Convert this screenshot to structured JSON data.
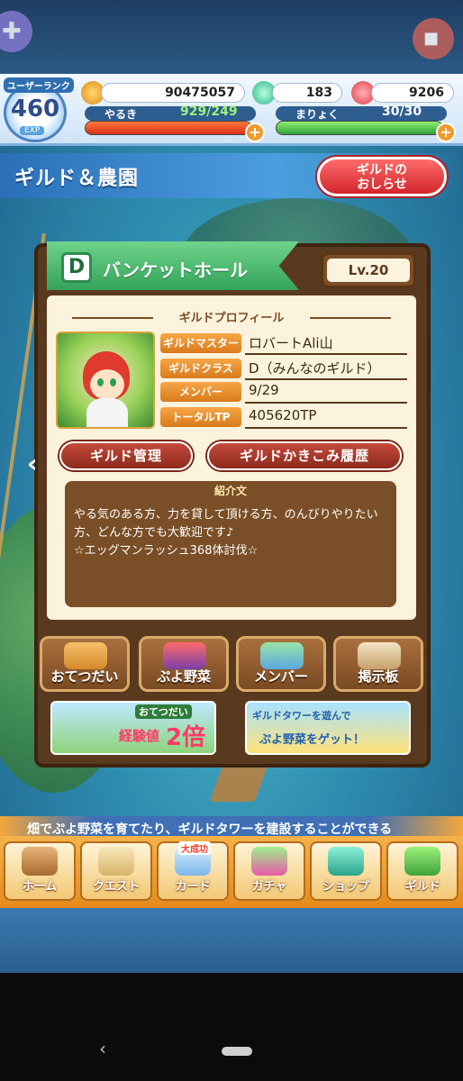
{
  "header": {
    "user_rank_label": "ユーザーランク",
    "user_rank": "460",
    "exp_label": "EXP",
    "coins": "90475057",
    "gems": "183",
    "tickets": "9206",
    "stamina_label": "やるき",
    "stamina": "929/249",
    "magic_label": "まりょく",
    "magic": "30/30",
    "plus": "+"
  },
  "title": {
    "text": "ギルド＆農園",
    "notice_button": "ギルドの\nおしらせ"
  },
  "guild": {
    "rank_letter": "D",
    "name": "バンケットホール",
    "level": "Lv.20",
    "profile_title": "ギルドプロフィール",
    "rows": [
      {
        "label": "ギルドマスター",
        "value": "ロバートAli山"
      },
      {
        "label": "ギルドクラス",
        "value": "D（みんなのギルド）"
      },
      {
        "label": "メンバー",
        "value": "9/29"
      },
      {
        "label": "トータルTP",
        "value": "405620TP"
      }
    ],
    "manage_button": "ギルド管理",
    "history_button": "ギルドかきこみ履歴",
    "intro_title": "紹介文",
    "intro_text": "やる気のある方、力を貸して頂ける方、のんびりやりたい方、どんな方でも大歓迎です♪\n☆エッグマンラッシュ368体討伐☆"
  },
  "tiles": [
    "おてつだい",
    "ぷよ野菜",
    "メンバー",
    "掲示板"
  ],
  "promos": {
    "left_line1": "おてつだい",
    "left_line2": "経験値",
    "left_line3": "2倍",
    "right_line1": "ギルドタワーを遊んで",
    "right_line2": "ぷよ野菜をゲット！"
  },
  "ticker": "畑でぷよ野菜を育てたり、ギルドタワーを建設することができる",
  "nav": {
    "items": [
      "ホーム",
      "クエスト",
      "カード",
      "ガチャ",
      "ショップ",
      "ギルド"
    ],
    "badge": "大成功"
  },
  "colors": {
    "accent": "#2a6fb8",
    "panel": "#5a3a1e",
    "paper": "#fbf3dc",
    "button_red": "#c44a3a",
    "nav_orange": "#f5b24a"
  }
}
